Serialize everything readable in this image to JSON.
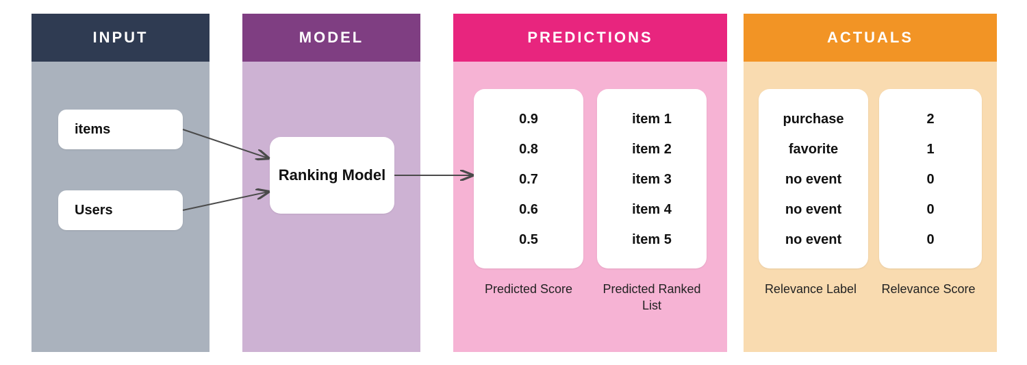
{
  "columns": {
    "input": {
      "title": "INPUT"
    },
    "model": {
      "title": "MODEL"
    },
    "predictions": {
      "title": "PREDICTIONS"
    },
    "actuals": {
      "title": "ACTUALS"
    }
  },
  "input": {
    "items_label": "items",
    "users_label": "Users"
  },
  "model": {
    "box_label": "Ranking Model"
  },
  "predictions": {
    "scores": [
      "0.9",
      "0.8",
      "0.7",
      "0.6",
      "0.5"
    ],
    "items": [
      "item 1",
      "item 2",
      "item 3",
      "item 4",
      "item 5"
    ],
    "score_caption": "Predicted Score",
    "list_caption": "Predicted Ranked List"
  },
  "actuals": {
    "labels": [
      "purchase",
      "favorite",
      "no event",
      "no event",
      "no event"
    ],
    "scores": [
      "2",
      "1",
      "0",
      "0",
      "0"
    ],
    "label_caption": "Relevance Label",
    "score_caption": "Relevance Score"
  },
  "colors": {
    "input_header": "#2f3b52",
    "input_body": "#aab2bd",
    "model_header": "#7f3e82",
    "model_body": "#cdb2d3",
    "pred_header": "#e8257e",
    "pred_body": "#f6b3d4",
    "act_header": "#f29425",
    "act_body": "#f9dbb0",
    "arrow": "#4a4a4a"
  }
}
